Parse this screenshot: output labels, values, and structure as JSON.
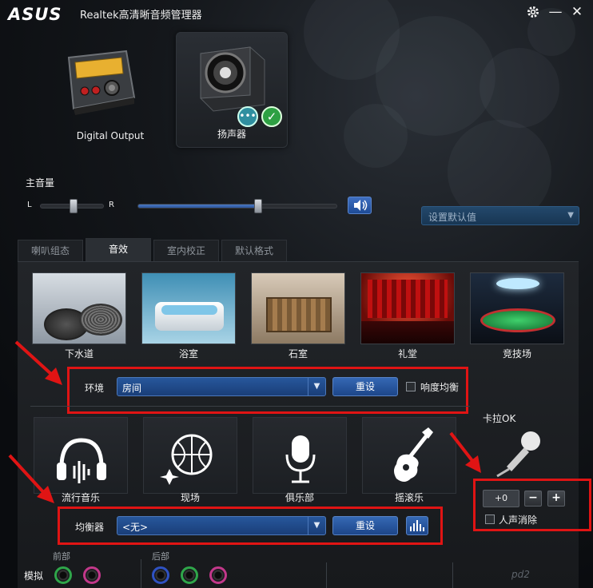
{
  "window": {
    "logo": "ASUS",
    "title": "Realtek高清晰音频管理器",
    "buttons": {
      "settings_icon": "gear-icon",
      "minimize": "—",
      "close": "✕"
    }
  },
  "devices": [
    {
      "label": "Digital Output",
      "selected": false,
      "icon": "digital-output-icon"
    },
    {
      "label": "扬声器",
      "selected": true,
      "icon": "speaker-icon"
    }
  ],
  "volume": {
    "title": "主音量",
    "balance_left": "L",
    "balance_right": "R",
    "balance": 0.5,
    "level": 0.6,
    "mute_icon": "speaker-volume-icon"
  },
  "default_device": {
    "placeholder": "设置默认值"
  },
  "tabs": [
    {
      "label": "喇叭组态",
      "active": false
    },
    {
      "label": "音效",
      "active": true
    },
    {
      "label": "室内校正",
      "active": false
    },
    {
      "label": "默认格式",
      "active": false
    }
  ],
  "environments": [
    {
      "label": "下水道"
    },
    {
      "label": "浴室"
    },
    {
      "label": "石室"
    },
    {
      "label": "礼堂"
    },
    {
      "label": "竞技场"
    }
  ],
  "environment_row": {
    "label": "环境",
    "value": "房间",
    "reset": "重设",
    "loudness_label": "响度均衡"
  },
  "equalizer_presets": [
    {
      "label": "流行音乐",
      "icon": "headphones-icon"
    },
    {
      "label": "现场",
      "icon": "disco-ball-icon"
    },
    {
      "label": "俱乐部",
      "icon": "microphone-icon"
    },
    {
      "label": "摇滚乐",
      "icon": "guitar-icon"
    }
  ],
  "equalizer_row": {
    "label": "均衡器",
    "value": "<无>",
    "reset": "重设",
    "graphic_eq_icon": "graphic-equalizer-icon"
  },
  "karaoke": {
    "title": "卡拉OK",
    "value": "+0",
    "minus": "−",
    "plus": "+",
    "vocal_cancel_label": "人声消除"
  },
  "jacks": {
    "front_label": "前部",
    "rear_label": "后部",
    "analog_label": "模拟"
  },
  "watermark": "pd2"
}
